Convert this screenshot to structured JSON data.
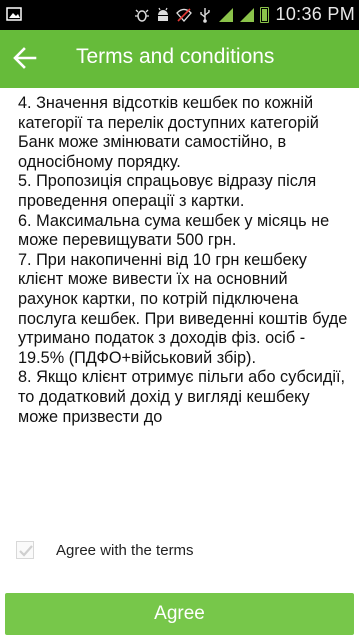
{
  "status_bar": {
    "time": "10:36 PM",
    "icons": [
      "image-notification-icon",
      "bug-icon",
      "android-icon",
      "wifi-off-icon",
      "usb-icon",
      "signal-icon",
      "signal-icon",
      "battery-icon"
    ]
  },
  "app_bar": {
    "title": "Terms and conditions",
    "back_icon": "arrow-left-icon"
  },
  "terms_text": "4. Значення відсотків кешбек по кожній категорії та перелік доступних категорій Банк може змінювати самостійно, в односібному порядку.\n5. Пропозиція спрацьовує відразу після проведення операції з картки.\n6. Максимальна сума кешбек у місяць не може перевищувати 500 грн.\n7. При накопиченні від 10 грн кешбеку клієнт може вивести їх на основний рахунок картки, по котрій підключена послуга кешбек. При виведенні коштів буде утримано податок з доходів фіз. осіб - 19.5% (ПДФО+військовий збір).\n8. Якщо клієнт отримує пільги або субсидії, то додатковий дохід у вигляді кешбеку може призвести до",
  "agree": {
    "checkbox_label": "Agree with the terms",
    "checked": true,
    "button_label": "Agree"
  },
  "colors": {
    "accent": "#66bb3a",
    "button": "#77c74a",
    "status_bar": "#000000"
  }
}
